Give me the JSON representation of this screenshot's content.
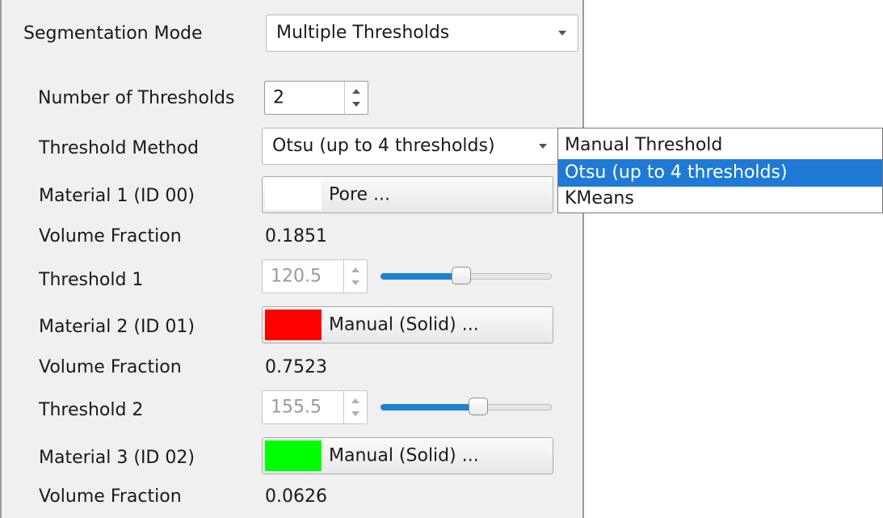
{
  "segmentation_mode": {
    "label": "Segmentation Mode",
    "value": "Multiple Thresholds"
  },
  "number_of_thresholds": {
    "label": "Number of Thresholds",
    "value": "2"
  },
  "threshold_method": {
    "label": "Threshold Method",
    "value": "Otsu (up to 4 thresholds)",
    "options": [
      "Manual Threshold",
      "Otsu (up to 4 thresholds)",
      "KMeans"
    ],
    "selected_index": 1
  },
  "materials": [
    {
      "label": "Material 1 (ID 00)",
      "button_text": "Pore ...",
      "color": "#ffffff",
      "volume_fraction_label": "Volume Fraction",
      "volume_fraction": "0.1851"
    },
    {
      "label": "Material 2 (ID 01)",
      "button_text": "Manual (Solid) ...",
      "color": "#ff0000",
      "volume_fraction_label": "Volume Fraction",
      "volume_fraction": "0.7523"
    },
    {
      "label": "Material 3 (ID 02)",
      "button_text": "Manual (Solid) ...",
      "color": "#00ff00",
      "volume_fraction_label": "Volume Fraction",
      "volume_fraction": "0.0626"
    }
  ],
  "thresholds": [
    {
      "label": "Threshold 1",
      "value": "120.5",
      "slider_fraction": 0.47
    },
    {
      "label": "Threshold 2",
      "value": "155.5",
      "slider_fraction": 0.58
    }
  ],
  "colors": {
    "accent": "#1f80d6",
    "selection": "#1e7ad6",
    "panel_bg": "#f0f0f0"
  }
}
